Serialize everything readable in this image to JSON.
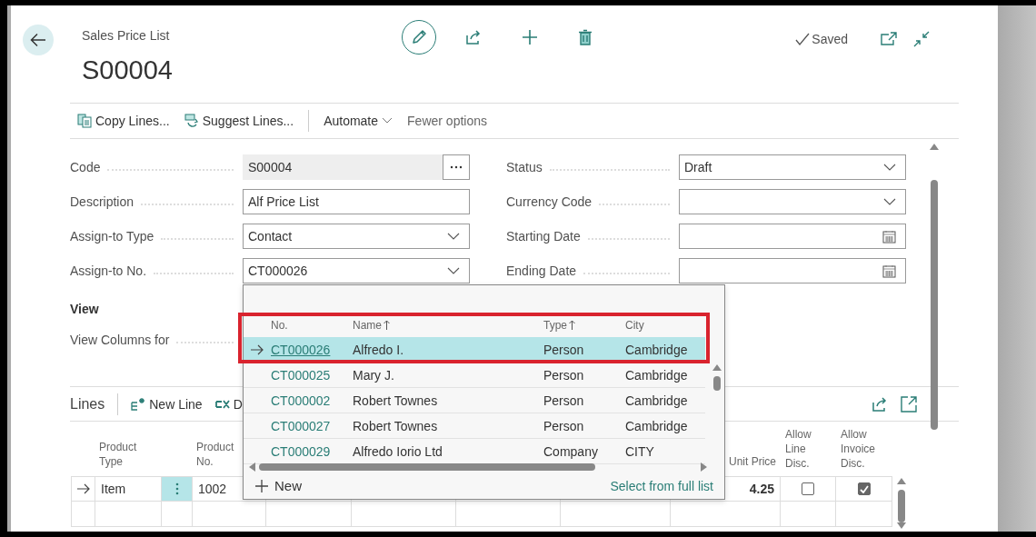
{
  "header": {
    "caption": "Sales Price List",
    "title": "S00004",
    "status": "Saved"
  },
  "actions": [
    {
      "kind": "copy",
      "label": "Copy Lines..."
    },
    {
      "kind": "suggest",
      "label": "Suggest Lines..."
    },
    {
      "kind": "menu",
      "label": "Automate"
    },
    {
      "kind": "plain",
      "label": "Fewer options"
    }
  ],
  "fields_left": [
    {
      "label": "Code",
      "value": "S00004",
      "kind": "lookup"
    },
    {
      "label": "Description",
      "value": "Alf Price List",
      "kind": "text"
    },
    {
      "label": "Assign-to Type",
      "value": "Contact",
      "kind": "dropdown"
    },
    {
      "label": "Assign-to No.",
      "value": "CT000026",
      "kind": "dropdown"
    }
  ],
  "fields_right": [
    {
      "label": "Status",
      "value": "Draft",
      "kind": "dropdown"
    },
    {
      "label": "Currency Code",
      "kind": "dropdown"
    },
    {
      "label": "Starting Date",
      "kind": "date"
    },
    {
      "label": "Ending Date",
      "kind": "date"
    }
  ],
  "view_group": {
    "title": "View",
    "fields": [
      {
        "label": "View Columns for"
      }
    ]
  },
  "lines": {
    "title": "Lines",
    "actions": [
      {
        "kind": "new",
        "label": "New Line"
      },
      {
        "kind": "delete",
        "label": "D"
      }
    ],
    "columns": {
      "product_type": "Product Type",
      "product_no": "Product No.",
      "unit_price": "Unit Price",
      "allow_line_disc": "Allow Line Disc.",
      "allow_invoice_disc": "Allow Invoice Disc."
    },
    "rows": [
      {
        "selected": true,
        "product_type": "Item",
        "product_no": "1002",
        "unit_price": "4.25",
        "allow_line_disc": false,
        "allow_invoice_disc": true
      }
    ]
  },
  "lookup": {
    "columns": [
      {
        "label": "No.",
        "sorted": false
      },
      {
        "label": "Name",
        "sorted": true
      },
      {
        "label": "Type",
        "sorted": true
      },
      {
        "label": "City",
        "sorted": false
      }
    ],
    "rows": [
      {
        "no": "CT000026",
        "name": "Alfredo I.",
        "type": "Person",
        "city": "Cambridge",
        "selected": true
      },
      {
        "no": "CT000025",
        "name": "Mary J.",
        "type": "Person",
        "city": "Cambridge",
        "selected": false
      },
      {
        "no": "CT000002",
        "name": "Robert Townes",
        "type": "Person",
        "city": "Cambridge",
        "selected": false
      },
      {
        "no": "CT000027",
        "name": "Robert Townes",
        "type": "Person",
        "city": "Cambridge",
        "selected": false
      },
      {
        "no": "CT000029",
        "name": "Alfredo Iorio Ltd",
        "type": "Company",
        "city": "CITY",
        "selected": false
      }
    ],
    "new_label": "New",
    "full_list_link": "Select from full list",
    "highlighted": true
  }
}
